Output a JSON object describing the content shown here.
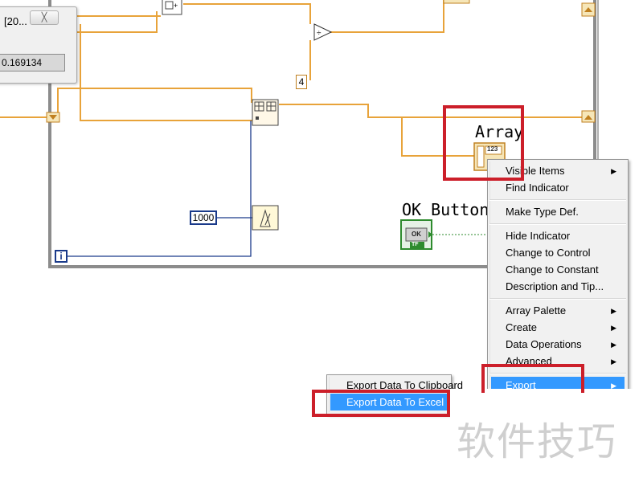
{
  "small_window": {
    "title": "[20...",
    "close_glyph": "╳",
    "value": "0.169134"
  },
  "constants": {
    "divisor": "4",
    "wait_ms": "1000",
    "iteration": "i"
  },
  "labels": {
    "array": "Array",
    "ok_button": "OK Button",
    "ok_glyph": "OK",
    "tf": "TF",
    "array_type": "123"
  },
  "context_menu": {
    "items": [
      {
        "label": "Visible Items",
        "has_submenu": true
      },
      {
        "label": "Find Indicator",
        "has_submenu": false
      },
      {
        "label": "Make Type Def.",
        "has_submenu": false
      },
      {
        "label": "Hide Indicator",
        "has_submenu": false
      },
      {
        "label": "Change to Control",
        "has_submenu": false
      },
      {
        "label": "Change to Constant",
        "has_submenu": false
      },
      {
        "label": "Description and Tip...",
        "has_submenu": false
      },
      {
        "label": "Array Palette",
        "has_submenu": true
      },
      {
        "label": "Create",
        "has_submenu": true
      },
      {
        "label": "Data Operations",
        "has_submenu": true
      },
      {
        "label": "Advanced",
        "has_submenu": true
      },
      {
        "label": "Export",
        "has_submenu": true,
        "highlighted": true
      }
    ],
    "arrow_glyph": "▶"
  },
  "export_submenu": {
    "items": [
      {
        "label": "Export Data To Clipboard",
        "highlighted": false
      },
      {
        "label": "Export Data To Excel",
        "highlighted": true
      }
    ]
  },
  "colors": {
    "wire_orange": "#e8a33a",
    "wire_blue": "#1a3a8a",
    "highlight": "#3399ff",
    "annotation_red": "#cc1f2a",
    "boolean_green": "#2e8b2e"
  },
  "watermark": "软件技巧"
}
